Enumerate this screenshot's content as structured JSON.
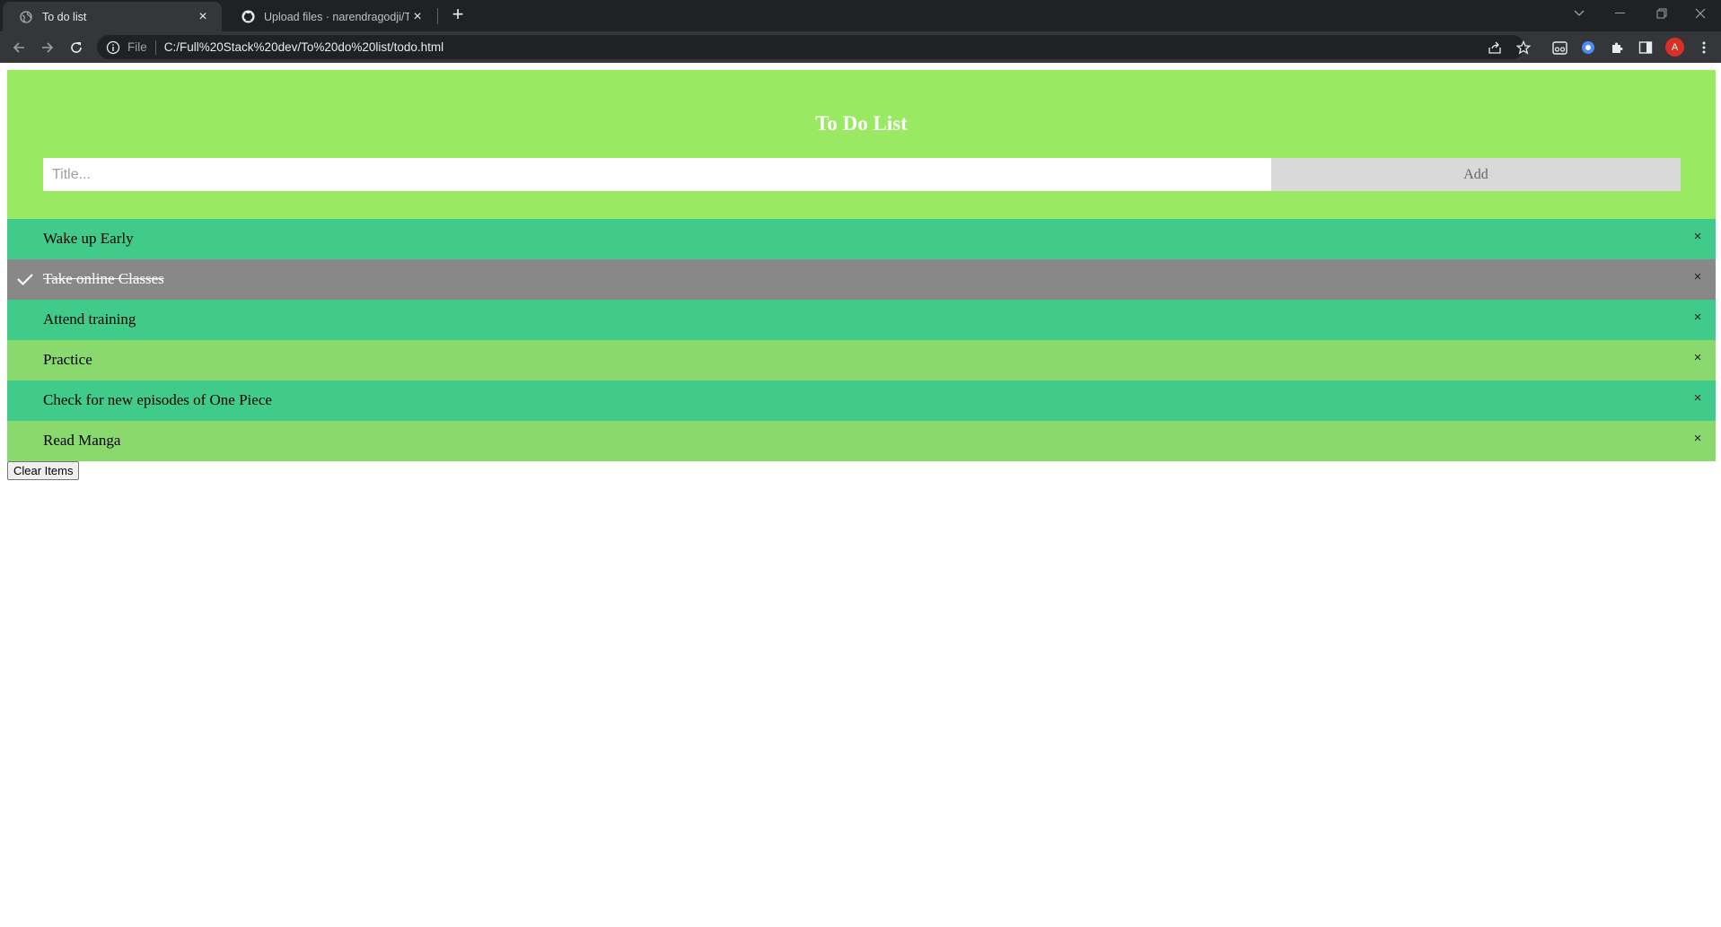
{
  "browser": {
    "tabs": [
      {
        "title": "To do list",
        "icon": "globe-icon"
      },
      {
        "title": "Upload files · narendragodji/Todo",
        "icon": "github-icon"
      }
    ],
    "address": {
      "scheme": "File",
      "url": "C:/Full%20Stack%20dev/To%20do%20list/todo.html"
    },
    "profile_initial": "A"
  },
  "page": {
    "heading": "To Do List",
    "input_placeholder": "Title...",
    "add_label": "Add",
    "items": [
      {
        "text": "Wake up Early",
        "checked": false,
        "color": "#41cb8b"
      },
      {
        "text": "Take online Classes",
        "checked": true,
        "color": "#888888"
      },
      {
        "text": "Attend training",
        "checked": false,
        "color": "#41cb8b"
      },
      {
        "text": "Practice",
        "checked": false,
        "color": "#89d96f"
      },
      {
        "text": "Check for new episodes of One Piece",
        "checked": false,
        "color": "#41cb8b"
      },
      {
        "text": "Read Manga",
        "checked": false,
        "color": "#89d96f"
      }
    ],
    "close_symbol": "×",
    "clear_label": "Clear Items"
  },
  "colors": {
    "header_bg": "#99e962",
    "add_bg": "#d9d9d9",
    "checked_bg": "#888888"
  }
}
